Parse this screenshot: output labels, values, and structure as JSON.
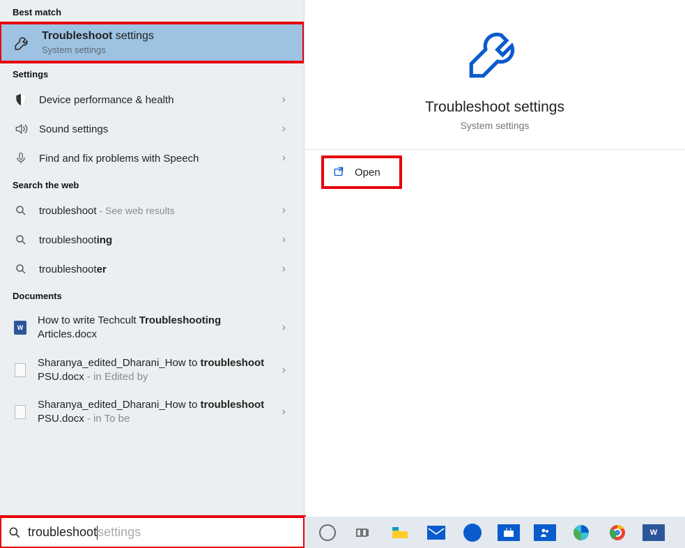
{
  "sections": {
    "best_match": "Best match",
    "settings": "Settings",
    "search_web": "Search the web",
    "documents": "Documents"
  },
  "best_match": {
    "title_bold": "Troubleshoot",
    "title_rest": " settings",
    "subtitle": "System settings"
  },
  "settings_items": [
    {
      "label": "Device performance & health"
    },
    {
      "label": "Sound settings"
    },
    {
      "label": "Find and fix problems with Speech"
    }
  ],
  "web_items": [
    {
      "prefix": "troubleshoot",
      "bold": "",
      "suffix_muted": " - See web results"
    },
    {
      "prefix": "troubleshoot",
      "bold": "ing",
      "suffix_muted": ""
    },
    {
      "prefix": "troubleshoot",
      "bold": "er",
      "suffix_muted": ""
    }
  ],
  "documents": [
    {
      "line1": "How to write Techcult ",
      "bold": "Troubleshooting",
      "after_bold": " Articles.docx",
      "meta": "",
      "icon": "word"
    },
    {
      "line1": "Sharanya_edited_Dharani_How to ",
      "bold": "troubleshoot",
      "after_bold": " PSU.docx",
      "meta": " - in Edited by",
      "icon": "doc"
    },
    {
      "line1": "Sharanya_edited_Dharani_How to ",
      "bold": "troubleshoot",
      "after_bold": " PSU.docx",
      "meta": " - in To be",
      "icon": "doc"
    }
  ],
  "preview": {
    "title": "Troubleshoot settings",
    "subtitle": "System settings",
    "open_label": "Open"
  },
  "search": {
    "typed": "troubleshoot",
    "ghost": " settings"
  },
  "taskbar": {
    "items": [
      "cortana",
      "taskview",
      "explorer",
      "mail",
      "dell",
      "store",
      "accounts",
      "edge",
      "chrome",
      "word"
    ]
  },
  "chevron": "›"
}
